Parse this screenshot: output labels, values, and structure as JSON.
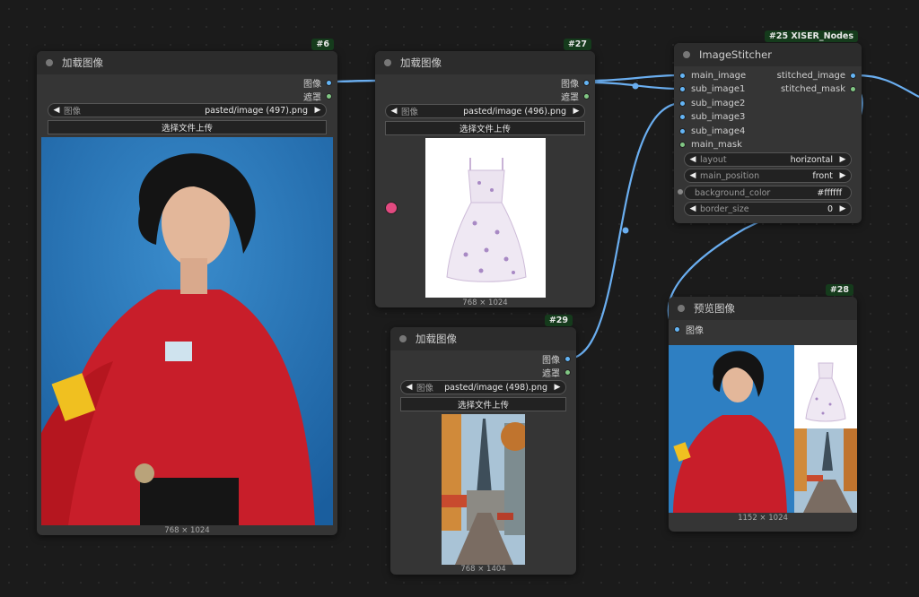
{
  "nodes": {
    "load1": {
      "id": "#6",
      "title": "加载图像",
      "out_image": "图像",
      "out_mask": "遮罩",
      "combo_label": "图像",
      "file": "pasted/image (497).png",
      "upload": "选择文件上传",
      "caption": "768 × 1024"
    },
    "load2": {
      "id": "#27",
      "title": "加载图像",
      "out_image": "图像",
      "out_mask": "遮罩",
      "combo_label": "图像",
      "file": "pasted/image (496).png",
      "upload": "选择文件上传",
      "caption": "768 × 1024"
    },
    "load3": {
      "id": "#29",
      "title": "加载图像",
      "out_image": "图像",
      "out_mask": "遮罩",
      "combo_label": "图像",
      "file": "pasted/image (498).png",
      "upload": "选择文件上传",
      "caption": "768 × 1404"
    },
    "stitcher": {
      "id": "#25 XISER_Nodes",
      "title": "ImageStitcher",
      "inputs": [
        "main_image",
        "sub_image2",
        "sub_image3",
        "sub_image4",
        "main_mask"
      ],
      "input_sub1": "sub_image1",
      "outputs": [
        "stitched_image",
        "stitched_mask"
      ],
      "layout_label": "layout",
      "layout_value": "horizontal",
      "position_label": "main_position",
      "position_value": "front",
      "bg_label": "background_color",
      "bg_value": "#ffffff",
      "border_label": "border_size",
      "border_value": "0"
    },
    "preview": {
      "id": "#28",
      "title": "预览图像",
      "input": "图像",
      "caption": "1152 × 1024"
    }
  },
  "colors": {
    "wire": "#6aaef0",
    "image_slot": "#64b5f6",
    "mask_slot": "#81c784",
    "badge": "#153b1c"
  }
}
